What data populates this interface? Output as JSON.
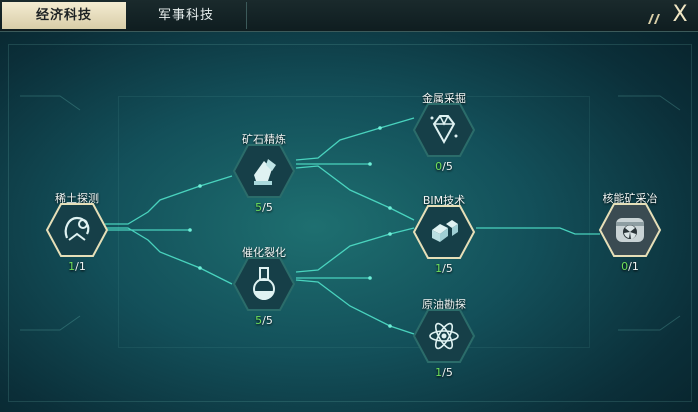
{
  "tabs": {
    "economy": "经济科技",
    "military": "军事科技"
  },
  "close_label": "X",
  "nodes": {
    "rare_earth": {
      "title": "稀土探测",
      "current": "1",
      "max": "/1"
    },
    "ore_refining": {
      "title": "矿石精炼",
      "current": "5",
      "max": "/5"
    },
    "catalytic_cracking": {
      "title": "催化裂化",
      "current": "5",
      "max": "/5"
    },
    "metal_mining": {
      "title": "金属采掘",
      "current": "0",
      "max": "/5"
    },
    "bim_tech": {
      "title": "BIM技术",
      "current": "1",
      "max": "/5"
    },
    "oil_exploration": {
      "title": "原油勘探",
      "current": "1",
      "max": "/5"
    },
    "nuclear_mining": {
      "title": "核能矿采冶",
      "current": "0",
      "max": "/1"
    }
  },
  "colors": {
    "progress_current": "#6fe05a",
    "link_line": "#4fe0c8",
    "hex_border": "#e6dfb8"
  },
  "icons": {
    "rare_earth": "probe-icon",
    "ore_refining": "ore-icon",
    "catalytic_cracking": "flask-icon",
    "metal_mining": "gem-icon",
    "bim_tech": "cube-icon",
    "oil_exploration": "atom-icon",
    "nuclear_mining": "nuclear-icon"
  }
}
